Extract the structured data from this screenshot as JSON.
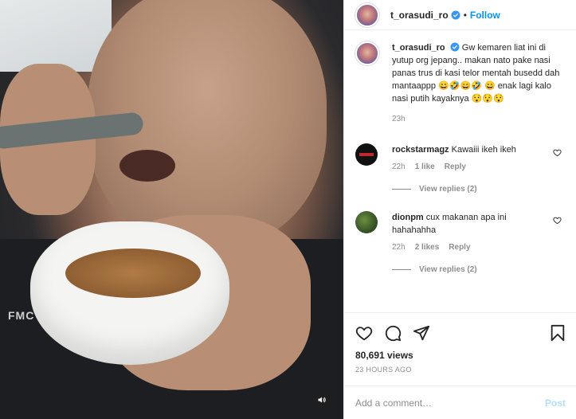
{
  "post": {
    "author": "t_orasudi_ro",
    "header_separator": "•",
    "follow_label": "Follow"
  },
  "caption": {
    "username": "t_orasudi_ro",
    "text": "Gw kemaren liat ini di yutup org jepang.. makan nato pake nasi panas trus di kasi telor mentah busedd dah mantaappp 😄🤣😄🤣 😄 enak lagi kalo nasi putih kayaknya 😯😯😯",
    "age": "23h"
  },
  "comments": [
    {
      "username": "rockstarmagz",
      "text": "Kawaiii ikeh ikeh",
      "age": "22h",
      "likes": "1 like",
      "reply_label": "Reply",
      "view_replies": "View replies (2)"
    },
    {
      "username": "dionpm",
      "text": "cux makanan apa ini hahahahha",
      "age": "22h",
      "likes": "2 likes",
      "reply_label": "Reply",
      "view_replies": "View replies (2)"
    }
  ],
  "video": {
    "shirt_text": "FMC"
  },
  "stats": {
    "views": "80,691 views",
    "timestamp": "23 HOURS AGO"
  },
  "composer": {
    "placeholder": "Add a comment…",
    "post_label": "Post"
  },
  "icons": {
    "verified": "verified-badge-icon",
    "like": "heart-icon",
    "comment": "comment-bubble-icon",
    "share": "paper-plane-icon",
    "save": "bookmark-icon",
    "audio": "speaker-icon"
  },
  "colors": {
    "accent": "#0095f6",
    "muted": "#8e8e8e",
    "post_disabled": "#b2dffc"
  }
}
